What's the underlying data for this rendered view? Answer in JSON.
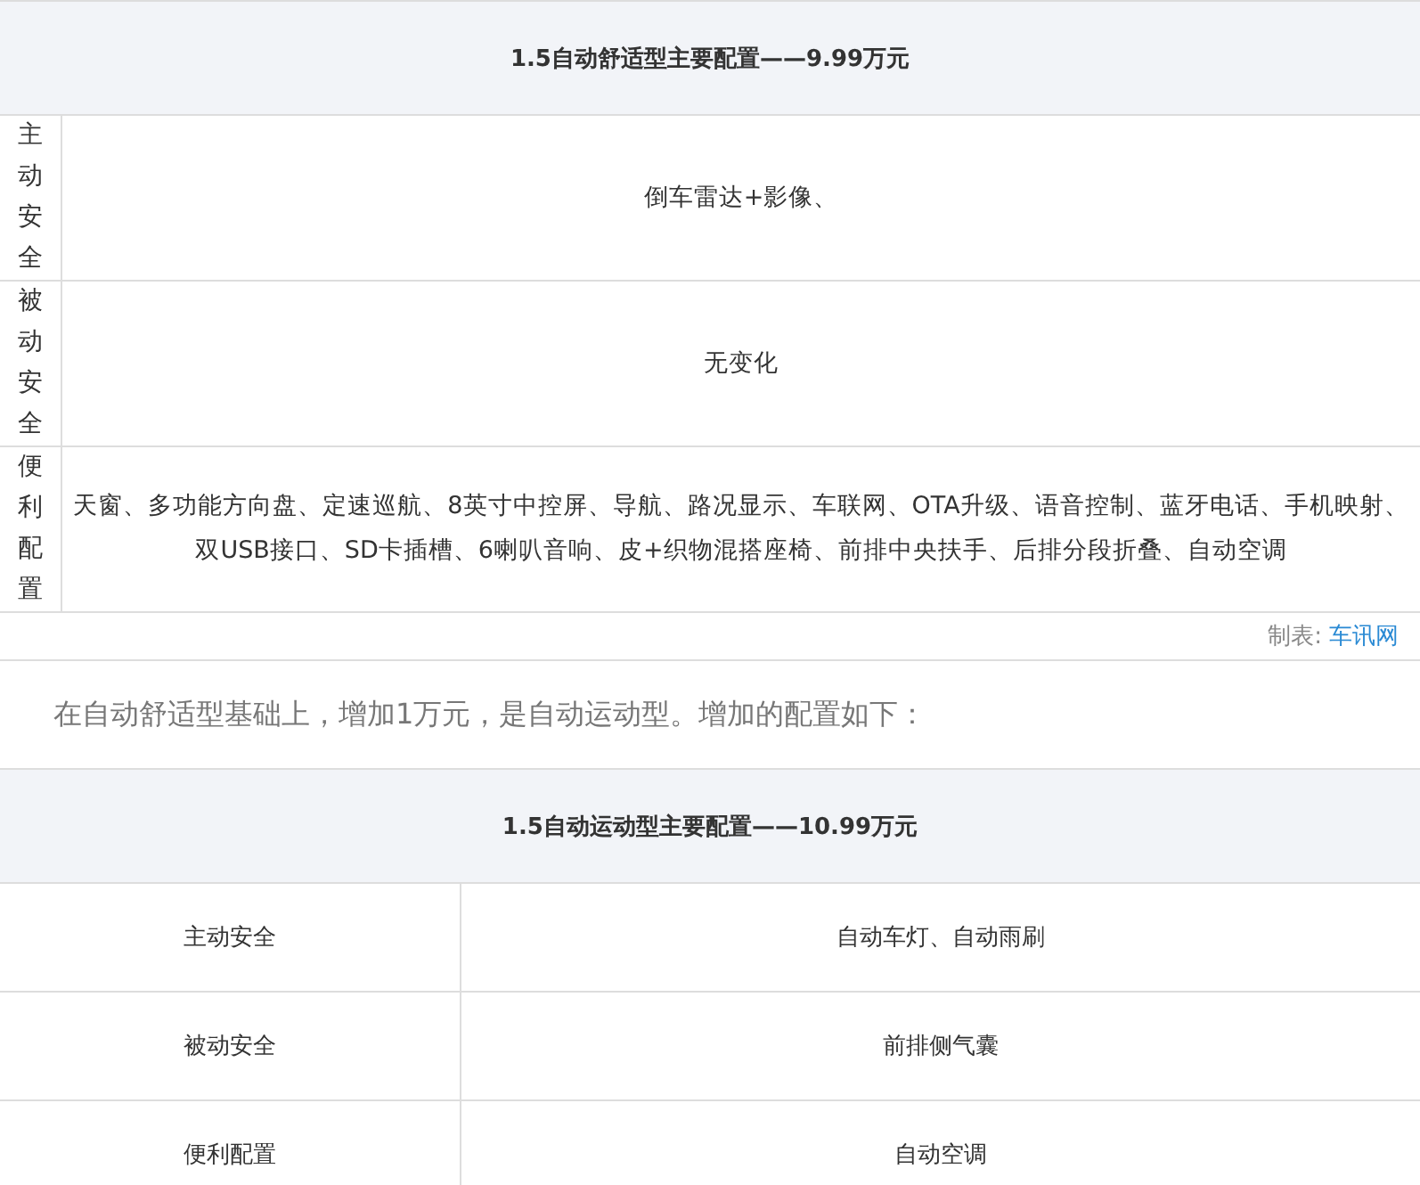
{
  "tables": [
    {
      "kind": "vertical",
      "title": "1.5自动舒适型主要配置——9.99万元",
      "rows": [
        {
          "label": "主动安全",
          "value": "倒车雷达+影像、"
        },
        {
          "label": "被动安全",
          "value": "无变化"
        },
        {
          "label": "便利配置",
          "value": "天窗、多功能方向盘、定速巡航、8英寸中控屏、导航、路况显示、车联网、OTA升级、语音控制、蓝牙电话、手机映射、双USB接口、SD卡插槽、6喇叭音响、皮+织物混搭座椅、前排中央扶手、后排分段折叠、自动空调"
        }
      ],
      "caption": {
        "label": "制表:",
        "source": "车讯网"
      }
    },
    {
      "kind": "paragraph",
      "text": "在自动舒适型基础上，增加1万元，是自动运动型。增加的配置如下："
    },
    {
      "kind": "horizontal",
      "title": "1.5自动运动型主要配置——10.99万元",
      "rows": [
        {
          "label": "主动安全",
          "value": "自动车灯、自动雨刷"
        },
        {
          "label": "被动安全",
          "value": "前排侧气囊"
        },
        {
          "label": "便利配置",
          "value": "自动空调"
        }
      ]
    }
  ]
}
